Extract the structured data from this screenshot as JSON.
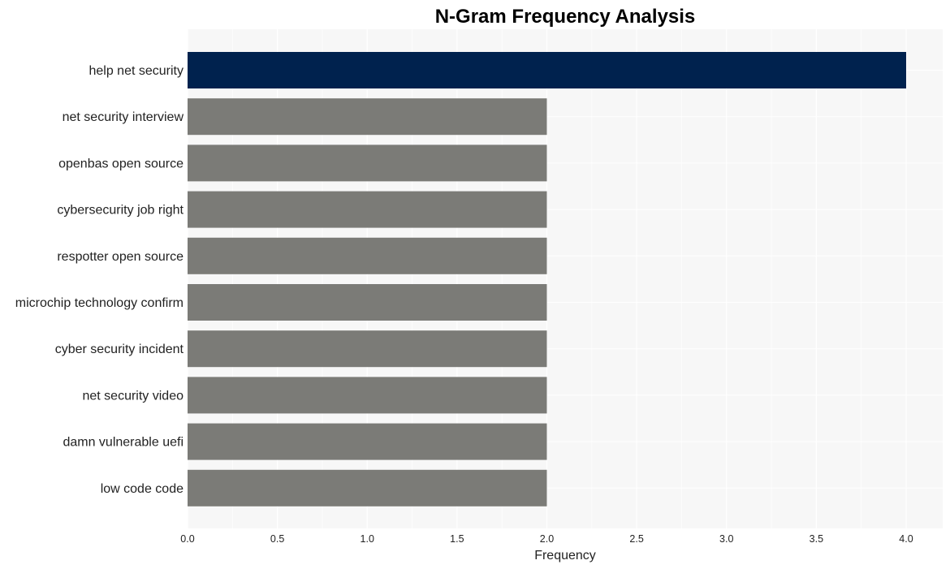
{
  "chart_data": {
    "type": "bar",
    "orientation": "horizontal",
    "title": "N-Gram Frequency Analysis",
    "xlabel": "Frequency",
    "ylabel": "",
    "categories": [
      "help net security",
      "net security interview",
      "openbas open source",
      "cybersecurity job right",
      "respotter open source",
      "microchip technology confirm",
      "cyber security incident",
      "net security video",
      "damn vulnerable uefi",
      "low code code"
    ],
    "values": [
      4,
      2,
      2,
      2,
      2,
      2,
      2,
      2,
      2,
      2
    ],
    "xlim": [
      0,
      4.2
    ],
    "xticks": [
      0.0,
      0.5,
      1.0,
      1.5,
      2.0,
      2.5,
      3.0,
      3.5,
      4.0
    ],
    "xtick_labels": [
      "0.0",
      "0.5",
      "1.0",
      "1.5",
      "2.0",
      "2.5",
      "3.0",
      "3.5",
      "4.0"
    ],
    "grid": true,
    "legend": "none",
    "colors": {
      "highlight": "#00224e",
      "default": "#7b7b77",
      "plot_background": "#f7f7f7",
      "grid": "#ffffff"
    }
  }
}
